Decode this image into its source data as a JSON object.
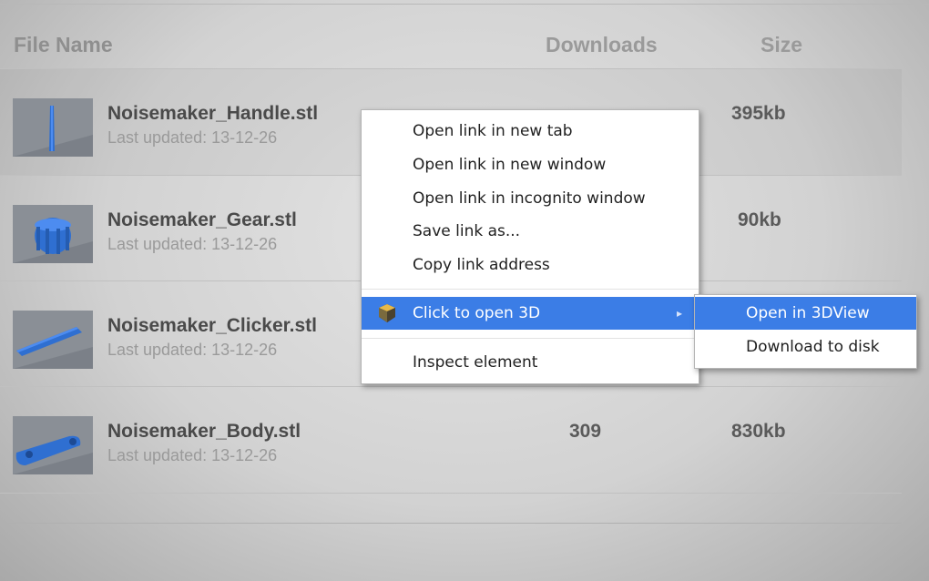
{
  "table": {
    "headers": {
      "name": "File Name",
      "downloads": "Downloads",
      "size": "Size"
    },
    "rows": [
      {
        "name": "Noisemaker_Handle.stl",
        "updated": "Last updated: 13-12-26",
        "downloads": "",
        "size": "395kb",
        "thumb": "handle"
      },
      {
        "name": "Noisemaker_Gear.stl",
        "updated": "Last updated: 13-12-26",
        "downloads": "",
        "size": "90kb",
        "thumb": "gear"
      },
      {
        "name": "Noisemaker_Clicker.stl",
        "updated": "Last updated: 13-12-26",
        "downloads": "",
        "size": "",
        "thumb": "clicker"
      },
      {
        "name": "Noisemaker_Body.stl",
        "updated": "Last updated: 13-12-26",
        "downloads": "309",
        "size": "830kb",
        "thumb": "body"
      }
    ]
  },
  "context_menu": {
    "items": [
      "Open link in new tab",
      "Open link in new window",
      "Open link in incognito window",
      "Save link as...",
      "Copy link address"
    ],
    "extension_item": {
      "label": "Click to open 3D",
      "icon": "3d-cube-icon",
      "arrow": "▸"
    },
    "inspect": "Inspect element",
    "highlight_color": "#3b7de6"
  },
  "submenu": {
    "items": [
      "Open in 3DView",
      "Download to disk"
    ]
  }
}
